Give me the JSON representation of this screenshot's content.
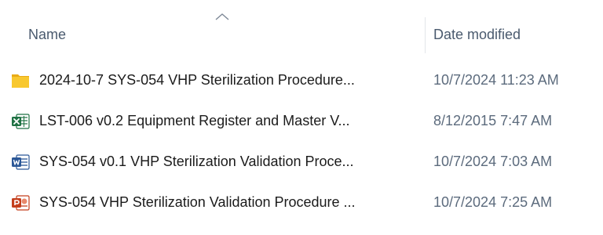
{
  "header": {
    "name_label": "Name",
    "date_label": "Date modified",
    "sort_indicator": "chevron-up-icon"
  },
  "files": [
    {
      "icon": "folder-icon",
      "name": "2024-10-7 SYS-054 VHP Sterilization Procedure...",
      "date": "10/7/2024 11:23 AM"
    },
    {
      "icon": "excel-icon",
      "name": "LST-006 v0.2 Equipment Register and Master V...",
      "date": "8/12/2015 7:47 AM"
    },
    {
      "icon": "word-icon",
      "name": "SYS-054 v0.1 VHP Sterilization Validation Proce...",
      "date": "10/7/2024 7:03 AM"
    },
    {
      "icon": "powerpoint-icon",
      "name": "SYS-054 VHP Sterilization Validation Procedure ...",
      "date": "10/7/2024 7:25 AM"
    }
  ],
  "colors": {
    "folder": "#f8c82f",
    "excel": "#1f7244",
    "word": "#2b5797",
    "powerpoint": "#c43e1c"
  }
}
